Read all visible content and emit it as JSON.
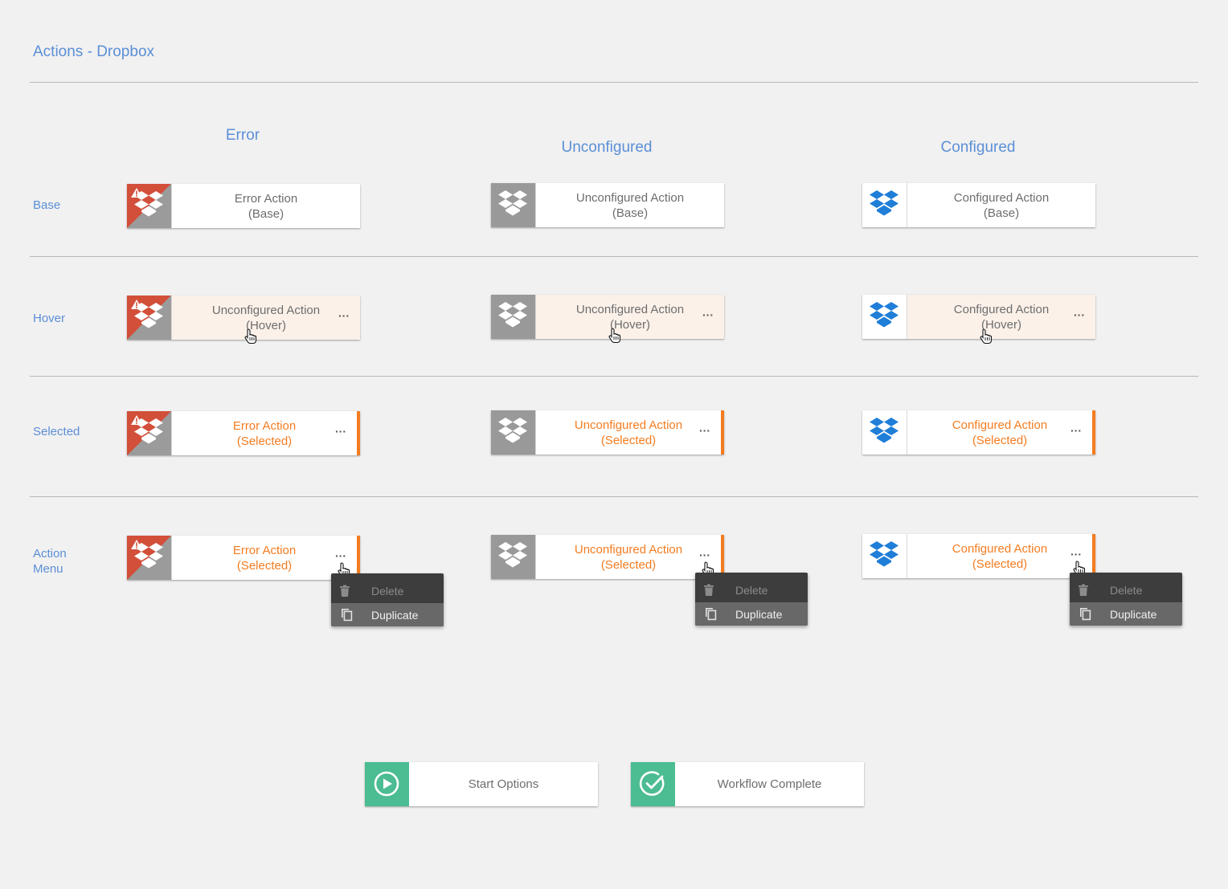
{
  "page": {
    "title": "Actions - Dropbox"
  },
  "columns": [
    "Error",
    "Unconfigured",
    "Configured"
  ],
  "rows": {
    "base": "Base",
    "hover": "Hover",
    "selected": "Selected",
    "action_menu_line1": "Action",
    "action_menu_line2": "Menu"
  },
  "cards": {
    "base": [
      {
        "name": "Error Action",
        "state": "(Base)"
      },
      {
        "name": "Unconfigured Action",
        "state": "(Base)"
      },
      {
        "name": "Configured Action",
        "state": "(Base)"
      }
    ],
    "hover": [
      {
        "name": "Unconfigured Action",
        "state": "(Hover)"
      },
      {
        "name": "Unconfigured Action",
        "state": "(Hover)"
      },
      {
        "name": "Configured Action",
        "state": "(Hover)"
      }
    ],
    "selected": [
      {
        "name": "Error Action",
        "state": "(Selected)"
      },
      {
        "name": "Unconfigured Action",
        "state": "(Selected)"
      },
      {
        "name": "Configured Action",
        "state": "(Selected)"
      }
    ],
    "menu": [
      {
        "name": "Error Action",
        "state": "(Selected)"
      },
      {
        "name": "Unconfigured Action",
        "state": "(Selected)"
      },
      {
        "name": "Configured Action",
        "state": "(Selected)"
      }
    ]
  },
  "more_label": "···",
  "action_menu": {
    "delete": "Delete",
    "duplicate": "Duplicate"
  },
  "bottom": {
    "start": "Start Options",
    "complete": "Workflow Complete"
  },
  "icons": {
    "error": "dropbox-error-icon",
    "unconfigured": "dropbox-unconfigured-icon",
    "configured": "dropbox-configured-icon",
    "warning": "warning-icon",
    "delete": "trash-icon",
    "duplicate": "copy-icon",
    "start": "play-circle-icon",
    "complete": "check-circle-icon"
  },
  "colors": {
    "accent_blue": "#5b8fd6",
    "error_red": "#d24f39",
    "selected_orange": "#f47c20",
    "hover_bg": "#fbf1e9",
    "dropbox_blue": "#1f7ed8",
    "green": "#4cbc92"
  }
}
